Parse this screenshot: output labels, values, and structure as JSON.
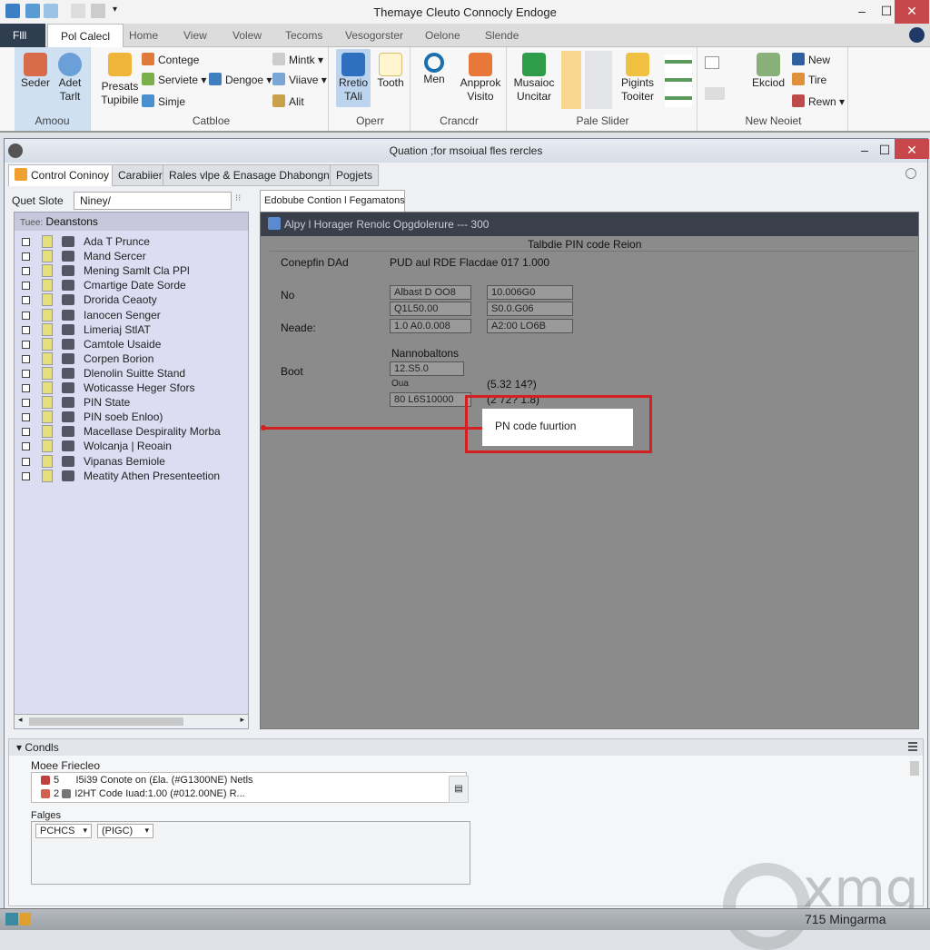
{
  "app": {
    "title": "Themaye Cleuto Connocly Endoge"
  },
  "ribbon_tabs": [
    "Flll",
    "Pol Calecl",
    "Home",
    "View",
    "Volew",
    "Tecoms",
    "Vesogorster",
    "Oelone",
    "Slende"
  ],
  "ribbon": {
    "groups": [
      {
        "label": "Amoou",
        "buttons": [
          "Seder",
          "Adet Tarlt"
        ]
      },
      {
        "label": "Catbloe",
        "buttons": [
          "Presats Tupibile",
          "Contege",
          "Serviete",
          "Dengoe",
          "Simje",
          "Mintk",
          "Viiave",
          "Alit"
        ]
      },
      {
        "label": "Operr",
        "buttons": [
          "Rretio TAli",
          "Tooth"
        ]
      },
      {
        "label": "Crancdr",
        "buttons": [
          "Men",
          "Anpprok Visito"
        ]
      },
      {
        "label": "Pale Slider",
        "buttons": [
          "Musaioc Uncitar",
          "Pigints Tooiter"
        ]
      },
      {
        "label": "New Neoiet",
        "buttons": [
          "Ekciod",
          "New",
          "Tire",
          "Rewn"
        ]
      }
    ]
  },
  "inner": {
    "title": "Quation ;for msoiual fles rercles",
    "tabs": [
      "Control Coninoy",
      "Carabiier",
      "Rales vlpe & Enasage Dhabongnis",
      "Pogjets"
    ],
    "search_label": "Quet Slote",
    "search_value": "Niney/",
    "tree_header_prefix": "Tuee:",
    "tree_header": "Deanstons",
    "tree": [
      "Ada T Prunce",
      "Mand Sercer",
      "Mening Samlt Cla PPl",
      "Cmartige Date Sorde",
      "Drorida Ceaoty",
      "Ianocen Senger",
      "Limeriaj StlAT",
      "Camtole Usaide",
      "Corpen Borion",
      "Dlenolin Suitte Stand",
      "Woticasse Heger Sfors",
      "PIN State",
      "PIN soeb Enloo)",
      "Macellase Despirality Morba",
      "Wolcanja | Reoain",
      "Vipanas Bemiole",
      "Meatity Athen Presenteetion"
    ],
    "right_tab": "Edobube Contion l Fegamatons",
    "panel_header": "Alpy l Horager Renolc Opgdolerure --- 300",
    "panel_subtitle": "Talbdie PIN code Reion",
    "rows": {
      "r1_label": "Conepfin DAd",
      "r1_value": "PUD aul RDE Flacdae 017 1.000",
      "r2_label": "No",
      "f1": "Albast D OO8",
      "f2": "10.006G0",
      "f3": "Q1L50.00",
      "f4": "S0.0.G06",
      "r3_label": "Neade:",
      "f5": "1.0 A0.0.008",
      "f6": "A2:00 LO6B",
      "section": "Nannobaltons",
      "r4_label": "Boot",
      "f7": "12.S5.0",
      "sub": "Oua",
      "f8": "(5.32 14?)",
      "f9": "80 L6S10000",
      "f10": "(2 72? 1.8)"
    },
    "callout": "PN code fuurtion",
    "callout_color": "#d42020"
  },
  "bottom": {
    "header": "Condls",
    "section1": "Moee Friecleo",
    "items": [
      {
        "num": "5",
        "text": "I5i39 Conote on (£la. (#G1300NE) Netls"
      },
      {
        "num": "2",
        "text": "I2HT Code Iuad:1.00 (#012.00NE) R..."
      }
    ],
    "section2": "Falges",
    "dropdowns": [
      "PCHCS",
      "(PIGC)"
    ]
  },
  "watermark": "xmg",
  "status": {
    "text": "715 Mingarma"
  }
}
